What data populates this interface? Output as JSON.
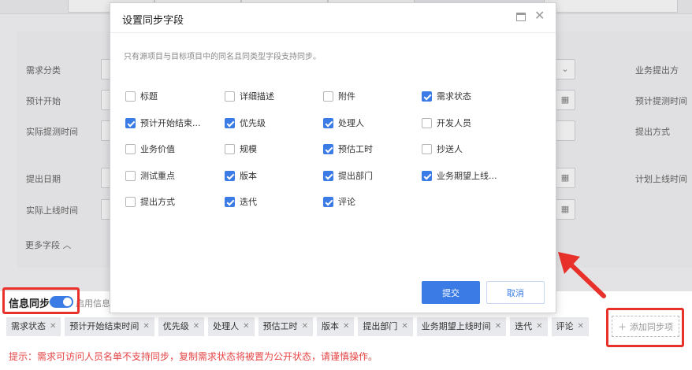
{
  "background_form": {
    "labels_left": [
      "需求分类",
      "预计开始",
      "实际提测时间",
      "提出日期",
      "实际上线时间"
    ],
    "labels_right": [
      "业务提出方",
      "预计提测时间",
      "提出方式",
      "计划上线时间"
    ],
    "more_fields": "更多字段"
  },
  "sync": {
    "title": "信息同步",
    "hint": "启用信息",
    "enabled": true,
    "tags": [
      "需求状态",
      "预计开始结束时间",
      "优先级",
      "处理人",
      "预估工时",
      "版本",
      "提出部门",
      "业务期望上线时间",
      "迭代",
      "评论"
    ],
    "add_button": "添加同步项",
    "tip": "提示：需求可访问人员名单不支持同步，复制需求状态将被置为公开状态，请谨慎操作。"
  },
  "dialog": {
    "title": "设置同步字段",
    "description": "只有源项目与目标项目中的同名且同类型字段支持同步。",
    "fields": [
      {
        "label": "标题",
        "checked": false
      },
      {
        "label": "详细描述",
        "checked": false
      },
      {
        "label": "附件",
        "checked": false
      },
      {
        "label": "需求状态",
        "checked": true
      },
      {
        "label": "预计开始结束...",
        "checked": true
      },
      {
        "label": "优先级",
        "checked": true
      },
      {
        "label": "处理人",
        "checked": true
      },
      {
        "label": "开发人员",
        "checked": false
      },
      {
        "label": "业务价值",
        "checked": false
      },
      {
        "label": "规模",
        "checked": false
      },
      {
        "label": "预估工时",
        "checked": true
      },
      {
        "label": "抄送人",
        "checked": false
      },
      {
        "label": "测试重点",
        "checked": false
      },
      {
        "label": "版本",
        "checked": true
      },
      {
        "label": "提出部门",
        "checked": true
      },
      {
        "label": "业务期望上线...",
        "checked": true
      },
      {
        "label": "提出方式",
        "checked": false
      },
      {
        "label": "迭代",
        "checked": true
      },
      {
        "label": "评论",
        "checked": true
      }
    ],
    "submit": "提交",
    "cancel": "取消"
  },
  "colors": {
    "accent": "#3a7be6",
    "annotation": "#e8312a",
    "tip": "#e64545"
  }
}
